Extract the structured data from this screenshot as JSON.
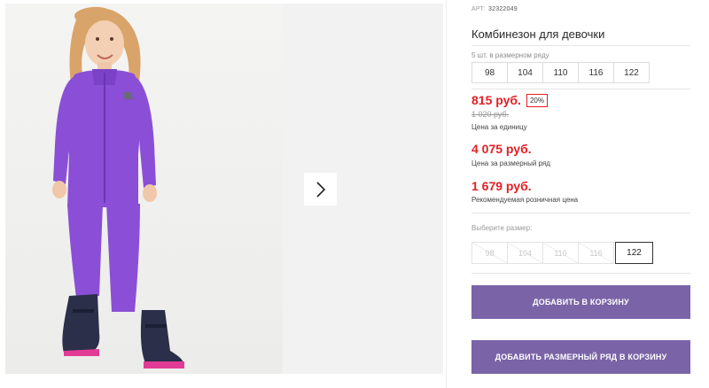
{
  "product": {
    "sku_label": "АРТ:",
    "sku_value": "32322049",
    "title": "Комбинезон для девочки"
  },
  "size_row": {
    "label": "5 шт. в размерном ряду",
    "sizes": [
      "98",
      "104",
      "110",
      "116",
      "122"
    ]
  },
  "pricing": {
    "unit_price": "815 руб.",
    "discount_badge": "20%",
    "old_price": "1 020 руб.",
    "unit_note": "Цена за единицу",
    "row_price": "4 075 руб.",
    "row_note": "Цена за размерный ряд",
    "retail_price": "1 679 руб.",
    "retail_note": "Рекомендуемая розничная цена"
  },
  "size_select": {
    "label": "Выберите размер:",
    "options": [
      "98",
      "104",
      "110",
      "116",
      "122"
    ],
    "selected": "122"
  },
  "actions": {
    "add_to_cart": "ДОБАВИТЬ В КОРЗИНУ",
    "add_row_to_cart": "ДОБАВИТЬ РАЗМЕРНЫЙ РЯД В КОРЗИНУ"
  },
  "colors": {
    "price_red": "#e31e24",
    "button_purple": "#7a64a7",
    "jumpsuit_purple": "#8a4fd6"
  }
}
